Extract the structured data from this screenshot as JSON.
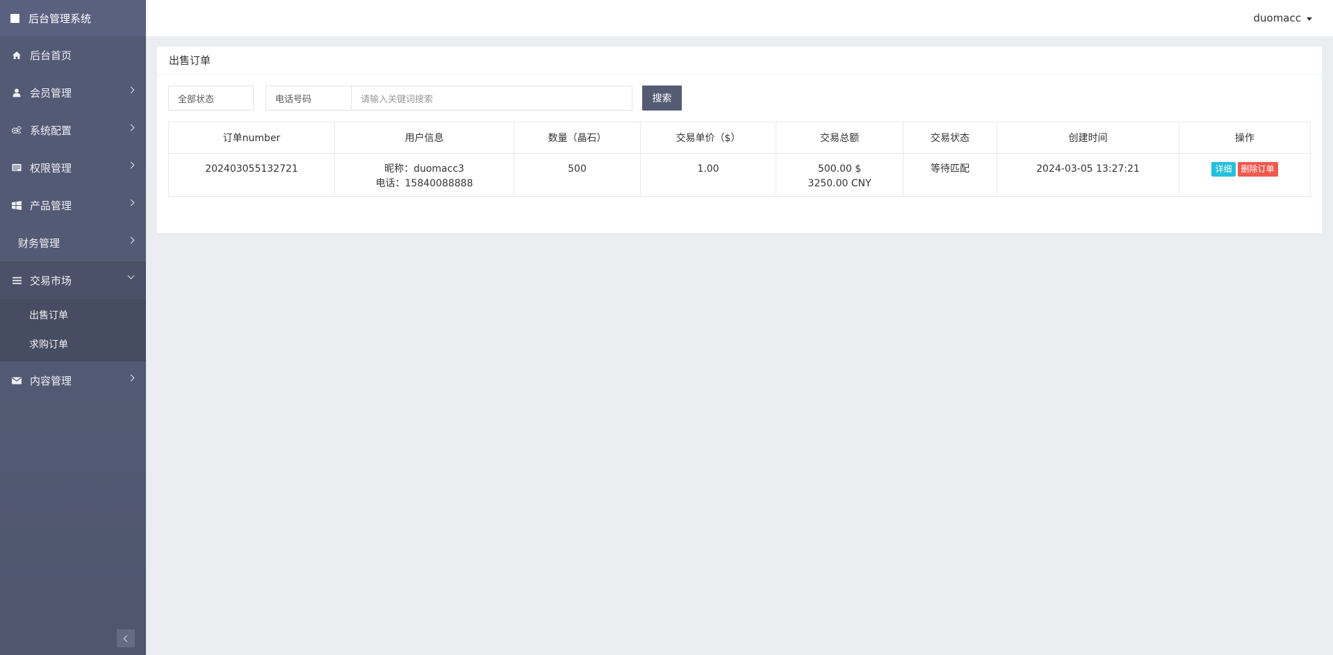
{
  "app": {
    "title": "后台管理系统"
  },
  "topbar": {
    "username": "duomacc"
  },
  "sidebar": {
    "items": [
      {
        "label": "后台首页",
        "icon": "home-icon"
      },
      {
        "label": "会员管理",
        "icon": "user-icon"
      },
      {
        "label": "系统配置",
        "icon": "gears-icon"
      },
      {
        "label": "权限管理",
        "icon": "cards-icon"
      },
      {
        "label": "产品管理",
        "icon": "windows-icon"
      },
      {
        "label": "财务管理",
        "icon": ""
      },
      {
        "label": "交易市场",
        "icon": "list-icon",
        "expanded": true,
        "children": [
          {
            "label": "出售订单"
          },
          {
            "label": "求购订单"
          }
        ]
      },
      {
        "label": "内容管理",
        "icon": "envelope-icon"
      }
    ]
  },
  "page": {
    "title": "出售订单",
    "filters": {
      "status_value": "全部状态",
      "field_value": "电话号码",
      "keyword_placeholder": "请输入关键词搜索",
      "search_label": "搜索"
    },
    "table": {
      "headers": [
        "订单number",
        "用户信息",
        "数量（晶石）",
        "交易单价（$）",
        "交易总额",
        "交易状态",
        "创建时间",
        "操作"
      ],
      "rows": [
        {
          "order_number": "202403055132721",
          "nickname": "昵称：duomacc3",
          "phone": "电话：15840088888",
          "quantity": "500",
          "unit_price": "1.00",
          "total_usd": "500.00 $",
          "total_cny": "3250.00 CNY",
          "status": "等待匹配",
          "created_at": "2024-03-05 13:27:21",
          "detail_label": "详细",
          "delete_label": "删除订单"
        }
      ]
    }
  },
  "colors": {
    "sidebar": "#525a74",
    "accent_button": "#545b73",
    "detail": "#26c0dd",
    "delete": "#f0594e"
  }
}
